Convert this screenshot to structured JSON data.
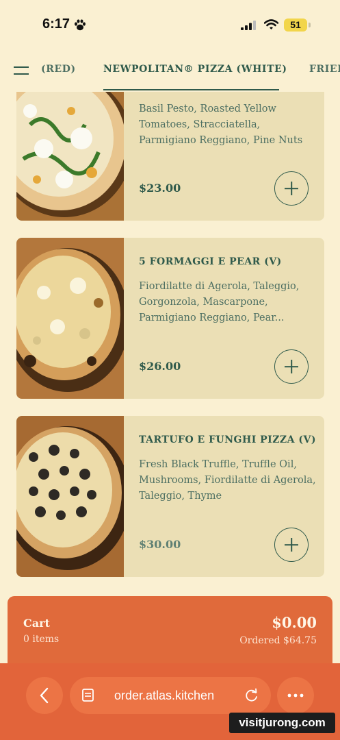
{
  "status_bar": {
    "time": "6:17",
    "battery": "51"
  },
  "category_nav": {
    "tabs": [
      {
        "label": "(RED)"
      },
      {
        "label": "NEWPOLITAN® PIZZA (WHITE)"
      },
      {
        "label": "FRIED"
      }
    ],
    "active_tab": "NEWPOLITAN® PIZZA (WHITE)"
  },
  "menu": {
    "items": [
      {
        "title": "",
        "description": "Basil Pesto, Roasted Yellow Tomatoes, Stracciatella, Parmigiano Reggiano, Pine Nuts",
        "price": "$23.00"
      },
      {
        "title": "5 FORMAGGI E PEAR (V)",
        "description": "Fiordilatte di Agerola, Taleggio, Gorgonzola, Mascarpone, Parmigiano Reggiano, Pear...",
        "price": "$26.00"
      },
      {
        "title": "TARTUFO E FUNGHI PIZZA (V)",
        "description": "Fresh Black Truffle, Truffle Oil, Mushrooms, Fiordilatte di Agerola, Taleggio, Thyme",
        "price": "$30.00"
      }
    ]
  },
  "cart": {
    "title": "Cart",
    "items": "0 items",
    "total": "$0.00",
    "ordered": "Ordered $64.75"
  },
  "browser": {
    "url": "order.atlas.kitchen"
  },
  "watermark": "visitjurong.com",
  "colors": {
    "background": "#faf0d2",
    "card": "#ebdfb5",
    "accent_green": "#2f5a4b",
    "cart_orange": "#e06a3b"
  }
}
